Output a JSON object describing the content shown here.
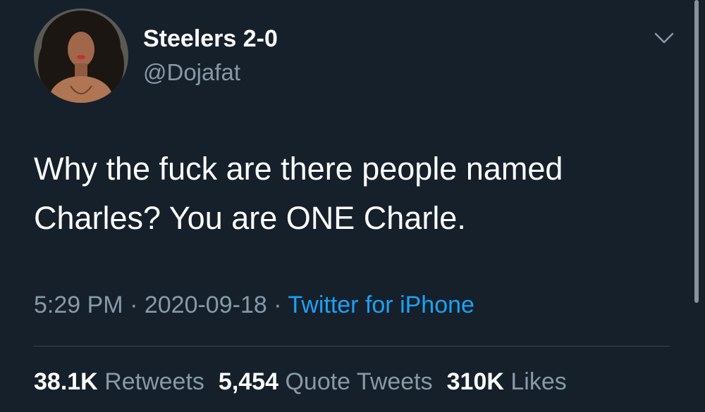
{
  "profile": {
    "display_name": "Steelers 2-0",
    "handle": "@Dojafat",
    "avatar_icon": "profile-photo"
  },
  "tweet": {
    "text_line_1": "Why the fuck are there people named",
    "text_line_2": "Charles? You are ONE Charle."
  },
  "meta": {
    "time": "5:29 PM",
    "separator_1": " · ",
    "date": "2020-09-18",
    "separator_2": " · ",
    "source": "Twitter for iPhone"
  },
  "stats": {
    "retweets_count": "38.1K",
    "retweets_label": "Retweets",
    "quotes_count": "5,454",
    "quotes_label": "Quote Tweets",
    "likes_count": "310K",
    "likes_label": "Likes"
  },
  "colors": {
    "background": "#15202b",
    "text": "#ffffff",
    "secondary": "#8899a6",
    "link": "#1da1f2",
    "divider": "#38444d"
  },
  "icons": {
    "more": "chevron-down-icon"
  }
}
